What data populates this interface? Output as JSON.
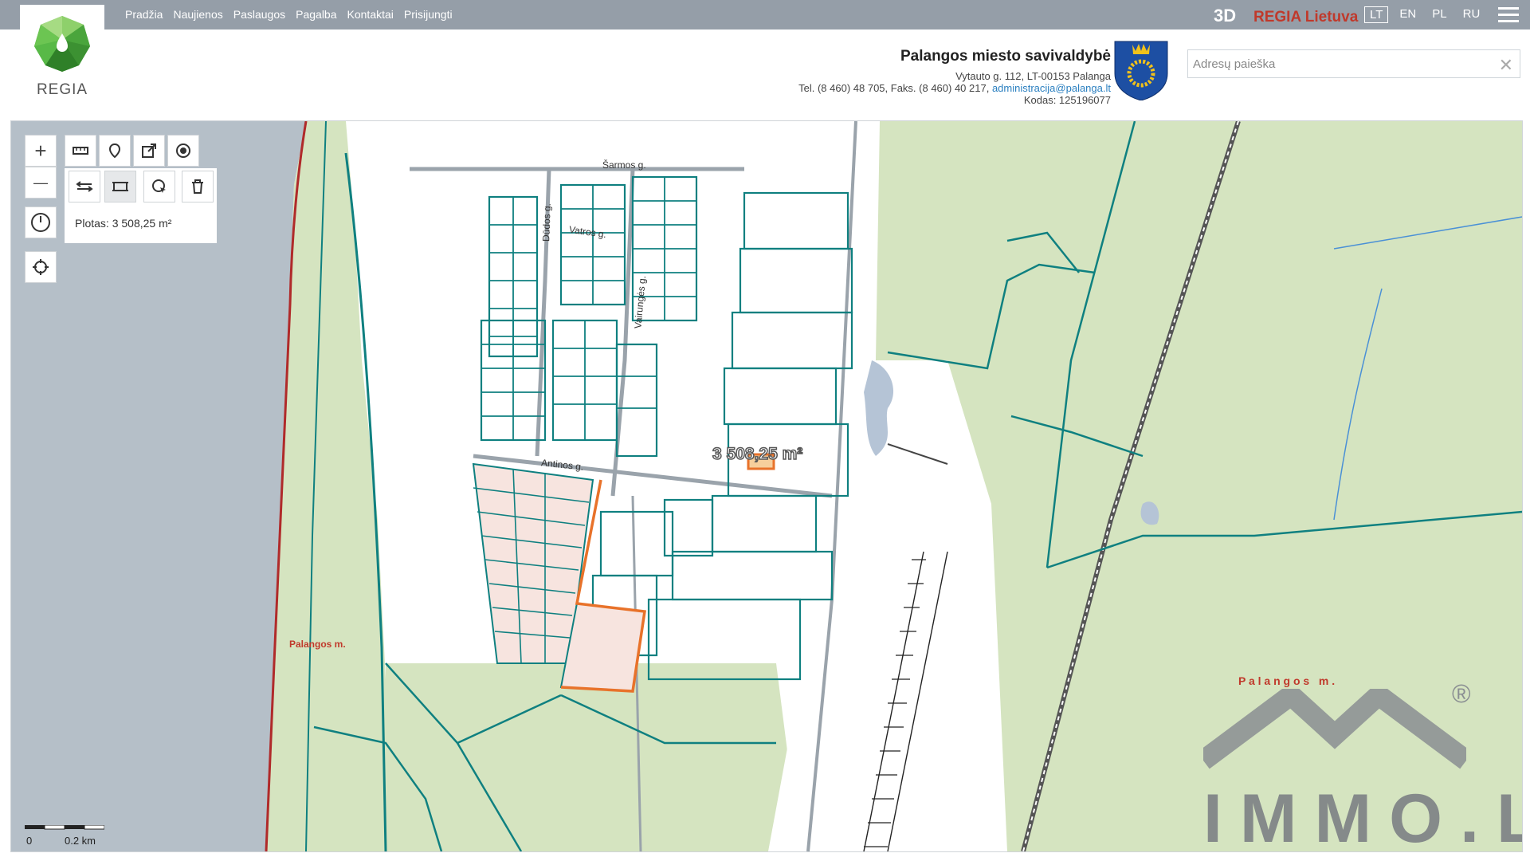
{
  "nav": {
    "items": [
      "Pradžia",
      "Naujienos",
      "Paslaugos",
      "Pagalba",
      "Kontaktai",
      "Prisijungti"
    ],
    "btn_3d": "3D",
    "regia_lietuva": "REGIA Lietuva",
    "languages": [
      "LT",
      "EN",
      "PL",
      "RU"
    ],
    "active_language": "LT"
  },
  "logo": {
    "text": "REGIA"
  },
  "municipality": {
    "title": "Palangos miesto savivaldybė",
    "address": "Vytauto g. 112, LT-00153 Palanga",
    "phone": "Tel. (8 460) 48 705, Faks. (8 460) 40 217, ",
    "email": "administracija@palanga.lt",
    "code": "Kodas: 125196077"
  },
  "search": {
    "placeholder": "Adresų paieška"
  },
  "tools": {
    "zoom_in": "+",
    "zoom_out": "—",
    "area_label": "Plotas: 3 508,25 m²"
  },
  "map": {
    "measure_label": "3 508,25 m²",
    "place_label_left": "Palangos m.",
    "place_label_right": "P a l a n g o s   m .",
    "streets": [
      "Šarmos g.",
      "Vatros g.",
      "Dūdos g.",
      "Vairungės g.",
      "Antinos g."
    ],
    "scale": {
      "zero": "0",
      "distance": "0.2 km"
    }
  },
  "watermark": {
    "text": "IMMO.LT",
    "mark": "®"
  },
  "colors": {
    "topbar": "#959ea8",
    "sea": "#b5bfc8",
    "forest": "#d5e4c0",
    "parcel": "#0f8080",
    "highlight": "#e8722a",
    "brand_red": "#c0392b"
  }
}
